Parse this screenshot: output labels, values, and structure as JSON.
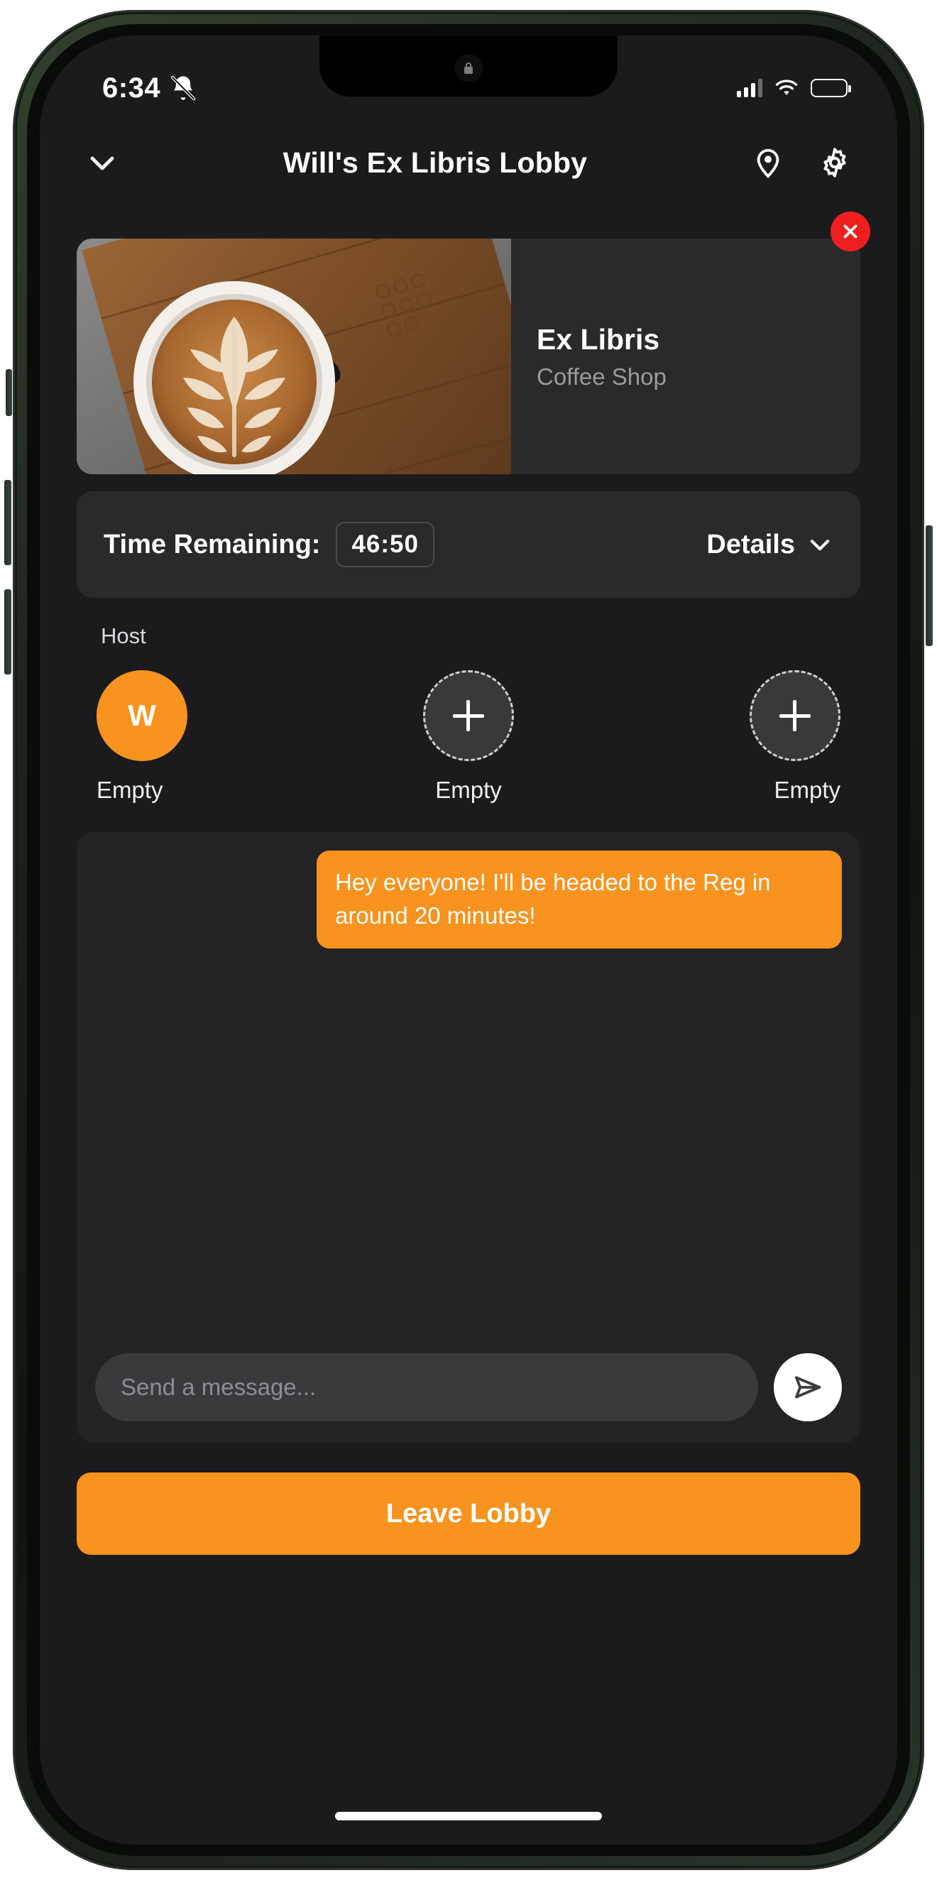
{
  "status_bar": {
    "time": "6:34",
    "silent_icon": "bell-slash-icon",
    "signal_icon": "cellular-signal-icon",
    "wifi_icon": "wifi-icon",
    "battery_icon": "battery-icon",
    "battery_level_pct": 62
  },
  "header": {
    "back_icon": "chevron-down-icon",
    "title": "Will's Ex Libris Lobby",
    "location_icon": "location-pin-icon",
    "settings_icon": "gear-icon"
  },
  "venue": {
    "name": "Ex Libris",
    "category": "Coffee Shop",
    "photo_alt": "latte-art-coffee-photo",
    "close_icon": "close-icon",
    "close_color": "#f01f1f"
  },
  "timer": {
    "label": "Time Remaining:",
    "value": "46:50",
    "details_label": "Details",
    "details_icon": "chevron-down-icon"
  },
  "roster": {
    "host_label": "Host",
    "slots": [
      {
        "initial": "W",
        "name": "Empty",
        "state": "filled",
        "add_icon": ""
      },
      {
        "initial": "",
        "name": "Empty",
        "state": "empty",
        "add_icon": "plus-icon"
      },
      {
        "initial": "",
        "name": "Empty",
        "state": "empty",
        "add_icon": "plus-icon"
      }
    ]
  },
  "chat": {
    "messages": [
      {
        "text": "Hey everyone! I'll be headed to the Reg in around 20 minutes!",
        "side": "outgoing"
      }
    ],
    "input_value": "",
    "input_placeholder": "Send a message...",
    "send_icon": "send-paper-plane-icon"
  },
  "footer": {
    "leave_label": "Leave Lobby"
  },
  "theme": {
    "accent": "#f7931e",
    "screen_bg": "#1b1b1d",
    "card_bg": "#2a2a2c",
    "panel_bg": "#232326"
  }
}
